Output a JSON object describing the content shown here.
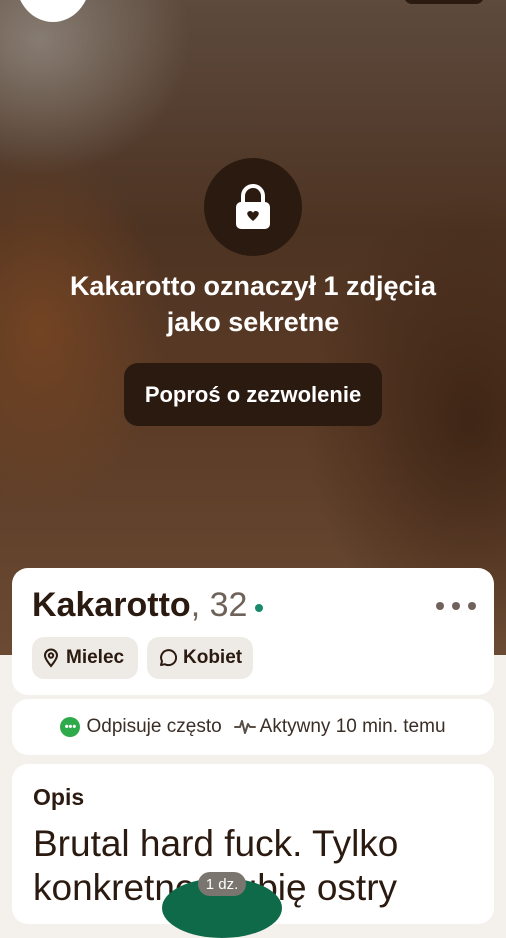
{
  "hero": {
    "secret_message_line1": "Kakarotto oznaczył 1 zdjęcia",
    "secret_message_line2": "jako sekretne",
    "request_button_label": "Poproś o zezwolenie",
    "lock_icon": "lock-heart-icon"
  },
  "profile": {
    "name": "Kakarotto",
    "age_text": ", 32",
    "online": true,
    "more_icon": "more-horizontal-icon",
    "location": "Mielec",
    "looking_for": "Kobiet"
  },
  "activity": {
    "reply_text": "Odpisuje często",
    "active_text": "Aktywny 10 min. temu"
  },
  "description": {
    "title": "Opis",
    "text": "Brutal hard fuck. Tylko konkretne. Lubię ostry"
  },
  "badge": {
    "time": "1 dz."
  },
  "colors": {
    "dark_brown": "#2a1a10",
    "online_green": "#1a8a6a",
    "reply_green": "#2eaa4a"
  }
}
